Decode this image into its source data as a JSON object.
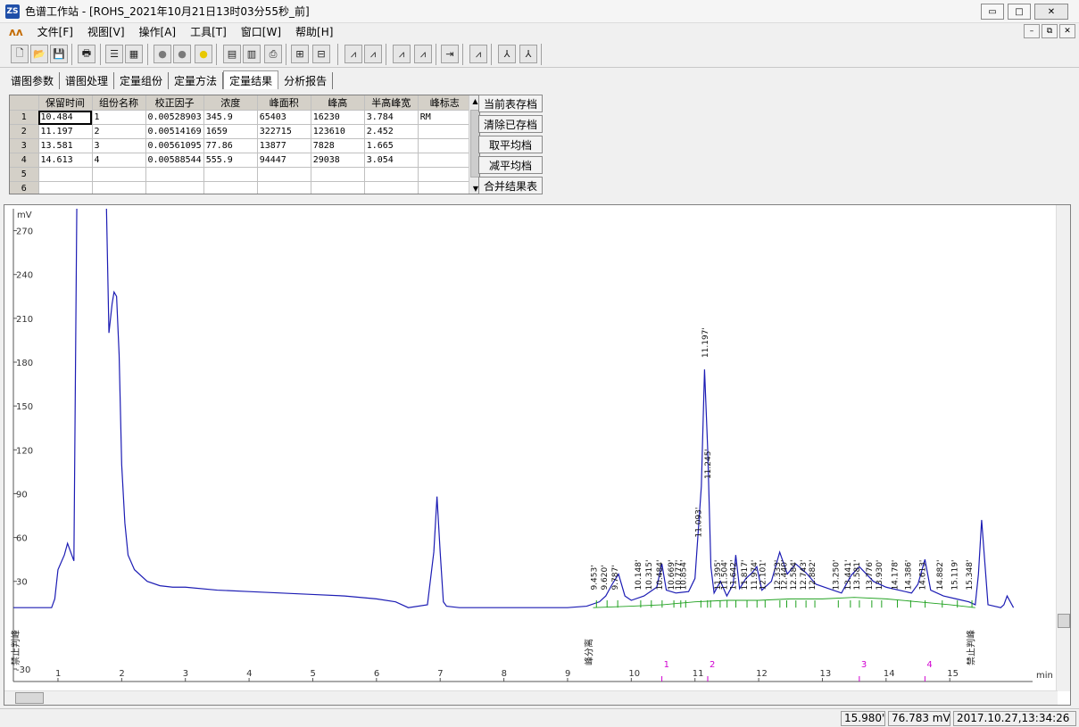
{
  "window": {
    "icon_text": "ZS",
    "title": "色谱工作站 - [ROHS_2021年10月21日13时03分55秒_前]",
    "controls": [
      "▭",
      "□",
      "✕"
    ]
  },
  "menu": {
    "logo": "ʌʌ",
    "items": [
      "文件[F]",
      "视图[V]",
      "操作[A]",
      "工具[T]",
      "窗口[W]",
      "帮助[H]"
    ],
    "mdi_controls": [
      "–",
      "⧉",
      "✕"
    ]
  },
  "toolbar": {
    "buttons": [
      {
        "name": "new-file-icon",
        "glyph": "🗋"
      },
      {
        "name": "open-folder-icon",
        "glyph": "📂"
      },
      {
        "name": "save-icon",
        "glyph": "💾"
      },
      {
        "name": "print-setup-icon",
        "glyph": "🖶"
      },
      {
        "name": "list-icon",
        "glyph": "☰"
      },
      {
        "name": "grid-icon",
        "glyph": "▦"
      },
      {
        "name": "stop-circle-icon",
        "glyph": "●"
      },
      {
        "name": "pause-circle-icon",
        "glyph": "●"
      },
      {
        "name": "run-circle-icon",
        "glyph": "●"
      },
      {
        "name": "calculator-icon",
        "glyph": "▤"
      },
      {
        "name": "report-icon",
        "glyph": "▥"
      },
      {
        "name": "printer-icon",
        "glyph": "⎙"
      },
      {
        "name": "export-icon",
        "glyph": "⊞"
      },
      {
        "name": "import-icon",
        "glyph": "⊟"
      },
      {
        "name": "chrom-view-1-icon",
        "glyph": "⩘"
      },
      {
        "name": "chrom-view-2-icon",
        "glyph": "⩘"
      },
      {
        "name": "chrom-view-3-icon",
        "glyph": "⩘"
      },
      {
        "name": "chrom-view-4-icon",
        "glyph": "⩘"
      },
      {
        "name": "baseline-icon",
        "glyph": "⇥"
      },
      {
        "name": "spectrum-icon",
        "glyph": "⩘"
      },
      {
        "name": "peak-mark-icon",
        "glyph": "⅄"
      },
      {
        "name": "peak-unmark-icon",
        "glyph": "⅄"
      }
    ],
    "colors": {
      "stop": "#7a7a7a",
      "pause": "#7a7a7a",
      "run": "#e8c800"
    }
  },
  "tabs": {
    "items": [
      "谱图参数",
      "谱图处理",
      "定量组份",
      "定量方法",
      "定量结果",
      "分析报告"
    ],
    "active_index": 4
  },
  "results_table": {
    "columns": [
      "",
      "保留时间",
      "组份名称",
      "校正因子",
      "浓度",
      "峰面积",
      "峰高",
      "半高峰宽",
      "峰标志"
    ],
    "rows": [
      [
        "1",
        "10.484",
        "1",
        "0.00528903",
        "345.9",
        "65403",
        "16230",
        "3.784",
        "RM"
      ],
      [
        "2",
        "11.197",
        "2",
        "0.00514169",
        "1659",
        "322715",
        "123610",
        "2.452",
        ""
      ],
      [
        "3",
        "13.581",
        "3",
        "0.00561095",
        "77.86",
        "13877",
        "7828",
        "1.665",
        ""
      ],
      [
        "4",
        "14.613",
        "4",
        "0.00588544",
        "555.9",
        "94447",
        "29038",
        "3.054",
        ""
      ],
      [
        "5",
        "",
        "",
        "",
        "",
        "",
        "",
        "",
        ""
      ],
      [
        "6",
        "",
        "",
        "",
        "",
        "",
        "",
        "",
        ""
      ]
    ],
    "scroll_up": "▲",
    "scroll_down": "▼"
  },
  "side_buttons": [
    "当前表存档",
    "清除已存档",
    "取平均档",
    "减平均档",
    "合并结果表"
  ],
  "chart_data": {
    "type": "line",
    "ylabel": "mV",
    "xlabel": "min",
    "xlim": [
      0.3,
      16.3
    ],
    "ylim": [
      -30,
      285
    ],
    "yticks": [
      -30,
      30,
      60,
      90,
      120,
      150,
      180,
      210,
      240,
      270
    ],
    "xticks": [
      1,
      2,
      3,
      4,
      5,
      6,
      7,
      8,
      9,
      10,
      11,
      12,
      13,
      14,
      15
    ],
    "series": [
      {
        "color": "#1c1cb4",
        "x": [
          0.3,
          0.9,
          0.95,
          1.0,
          1.1,
          1.15,
          1.2,
          1.25,
          1.3,
          1.35,
          1.4,
          1.45,
          1.5,
          1.55,
          1.6,
          1.65,
          1.7,
          1.75,
          1.8,
          1.85,
          1.88,
          1.92,
          1.96,
          2.0,
          2.05,
          2.1,
          2.2,
          2.4,
          2.6,
          2.8,
          3.0,
          3.5,
          4.0,
          4.5,
          5.0,
          5.5,
          6.0,
          6.3,
          6.5,
          6.8,
          6.9,
          6.95,
          7.0,
          7.05,
          7.1,
          7.3,
          8.0,
          9.0,
          9.3,
          9.5,
          9.6,
          9.7,
          9.8,
          9.9,
          10.0,
          10.2,
          10.4,
          10.48,
          10.55,
          10.7,
          10.9,
          11.0,
          11.1,
          11.15,
          11.2,
          11.25,
          11.3,
          11.4,
          11.5,
          11.6,
          11.64,
          11.7,
          11.8,
          11.9,
          11.97,
          12.05,
          12.2,
          12.33,
          12.45,
          12.58,
          12.74,
          12.9,
          13.1,
          13.3,
          13.45,
          13.58,
          13.8,
          14.0,
          14.2,
          14.4,
          14.5,
          14.61,
          14.7,
          14.9,
          15.1,
          15.3,
          15.4,
          15.45,
          15.5,
          15.6,
          15.8,
          15.85,
          15.9,
          16.0
        ],
        "y": [
          12,
          12,
          18,
          38,
          48,
          56,
          50,
          44,
          310,
          310,
          310,
          310,
          310,
          310,
          310,
          310,
          310,
          310,
          200,
          220,
          228,
          225,
          185,
          110,
          70,
          48,
          38,
          30,
          27,
          26,
          26,
          24,
          23,
          22,
          21,
          20,
          18,
          16,
          12,
          14,
          50,
          88,
          50,
          16,
          13,
          12,
          12,
          12,
          13,
          16,
          20,
          28,
          35,
          20,
          17,
          20,
          26,
          42,
          24,
          22,
          23,
          32,
          95,
          175,
          120,
          40,
          22,
          30,
          20,
          28,
          48,
          25,
          32,
          36,
          40,
          24,
          30,
          50,
          35,
          42,
          36,
          28,
          25,
          22,
          34,
          40,
          30,
          26,
          24,
          22,
          28,
          45,
          24,
          20,
          18,
          16,
          14,
          35,
          72,
          14,
          12,
          14,
          20,
          12
        ]
      },
      {
        "color": "#1fa11f",
        "name": "",
        "x": [
          9.4,
          10.0,
          10.5,
          11.0,
          11.5,
          12.0,
          12.5,
          13.0,
          13.5,
          14.0,
          14.5,
          15.0,
          15.4
        ],
        "y": [
          12,
          13,
          14,
          16,
          17,
          17,
          18,
          18,
          19,
          18,
          16,
          14,
          12
        ]
      }
    ],
    "peak_labels": [
      {
        "x": 9.453,
        "label": "9.453'"
      },
      {
        "x": 9.62,
        "label": "9.620'"
      },
      {
        "x": 9.787,
        "label": "9.787'"
      },
      {
        "x": 10.148,
        "label": "10.148'"
      },
      {
        "x": 10.315,
        "label": "10.315'"
      },
      {
        "x": 10.484,
        "label": "10.484'"
      },
      {
        "x": 10.669,
        "label": "10.669'"
      },
      {
        "x": 10.777,
        "label": "10.777'"
      },
      {
        "x": 10.854,
        "label": "10.854'"
      },
      {
        "x": 11.093,
        "label": "11.093'"
      },
      {
        "x": 11.197,
        "label": "11.197'"
      },
      {
        "x": 11.245,
        "label": "11.245'"
      },
      {
        "x": 11.395,
        "label": "11.395'"
      },
      {
        "x": 11.504,
        "label": "11.504'"
      },
      {
        "x": 11.642,
        "label": "11.642'"
      },
      {
        "x": 11.817,
        "label": "11.817'"
      },
      {
        "x": 11.974,
        "label": "11.974'"
      },
      {
        "x": 12.101,
        "label": "12.101'"
      },
      {
        "x": 12.333,
        "label": "12.333'"
      },
      {
        "x": 12.44,
        "label": "12.440'"
      },
      {
        "x": 12.584,
        "label": "12.584'"
      },
      {
        "x": 12.743,
        "label": "12.743'"
      },
      {
        "x": 12.882,
        "label": "12.882'"
      },
      {
        "x": 13.25,
        "label": "13.250'"
      },
      {
        "x": 13.44,
        "label": "13.441'"
      },
      {
        "x": 13.581,
        "label": "13.581'"
      },
      {
        "x": 13.776,
        "label": "13.776'"
      },
      {
        "x": 13.93,
        "label": "13.930'"
      },
      {
        "x": 14.178,
        "label": "14.178'"
      },
      {
        "x": 14.386,
        "label": "14.386'"
      },
      {
        "x": 14.613,
        "label": "14.613'"
      },
      {
        "x": 14.882,
        "label": "14.882'"
      },
      {
        "x": 15.119,
        "label": "15.119'"
      },
      {
        "x": 15.348,
        "label": "15.348'"
      }
    ],
    "event_labels": [
      {
        "x": 0.3,
        "label": "禁止判峰"
      },
      {
        "x": 9.3,
        "label": "峰分离"
      },
      {
        "x": 15.3,
        "label": "禁止判峰"
      }
    ],
    "component_markers": [
      {
        "x": 10.48,
        "label": "1"
      },
      {
        "x": 11.2,
        "label": "2"
      },
      {
        "x": 13.58,
        "label": "3"
      },
      {
        "x": 14.61,
        "label": "4"
      }
    ]
  },
  "status": {
    "time": "15.980'",
    "voltage": "76.783 mV",
    "datetime": "2017.10.27,13:34:26"
  }
}
